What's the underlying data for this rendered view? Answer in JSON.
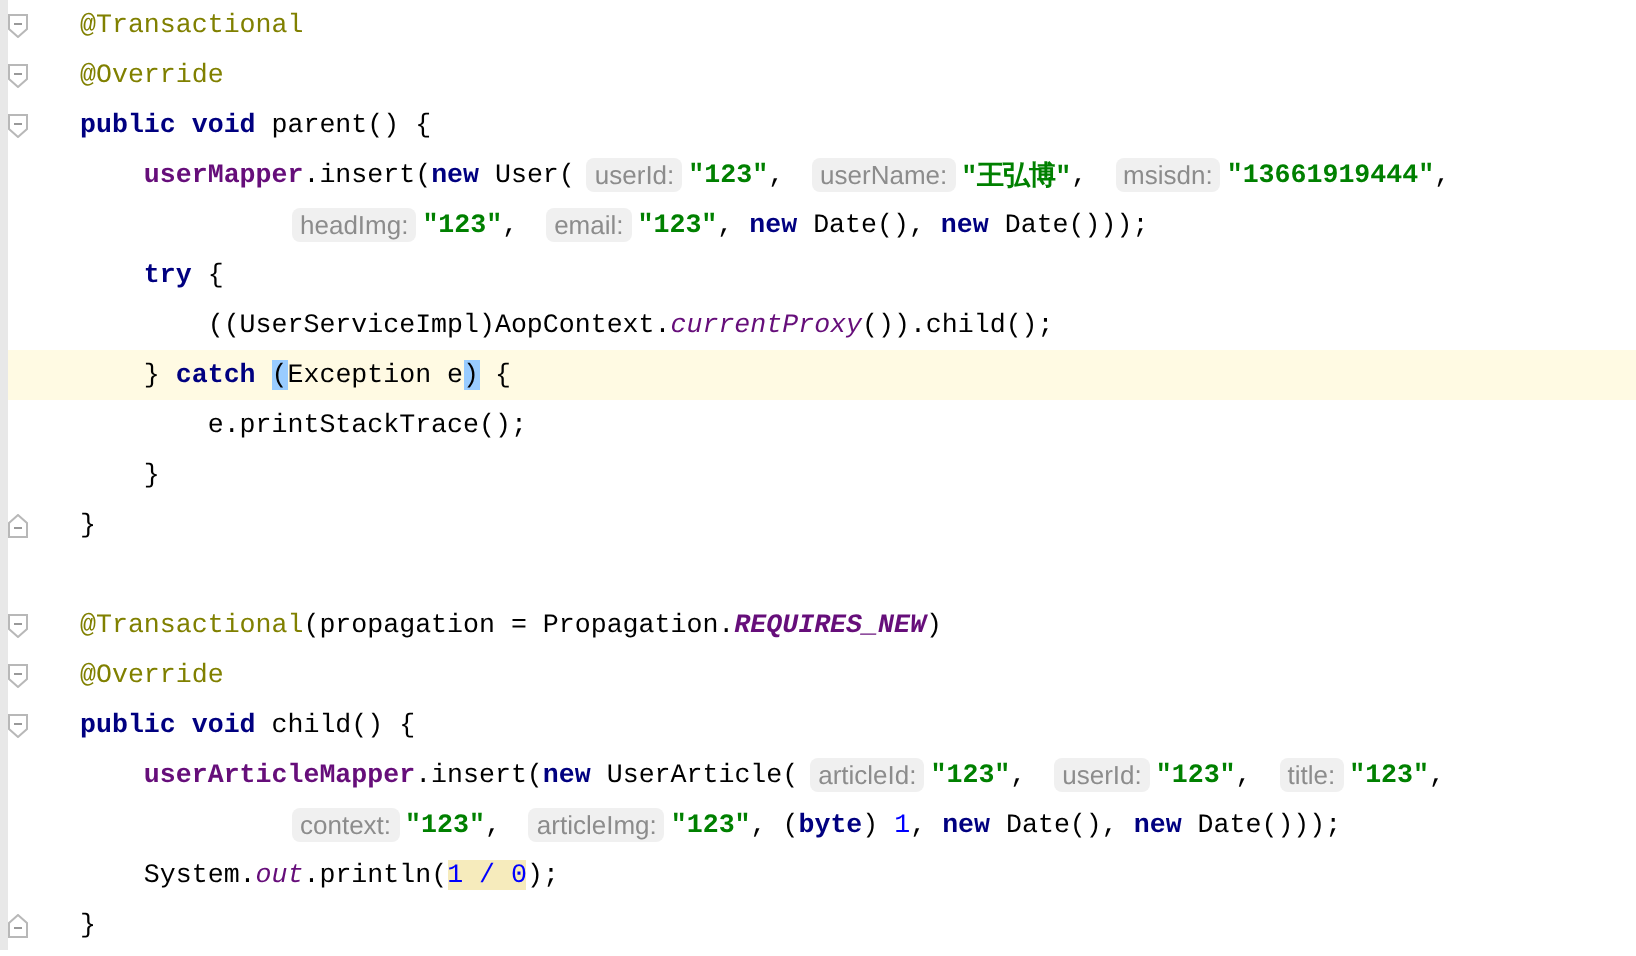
{
  "editor": {
    "lines": [
      {
        "current": false,
        "kind": "opener",
        "tokens": [
          {
            "kind": "annotation",
            "text": "@Transactional"
          }
        ]
      },
      {
        "current": false,
        "kind": "opener",
        "tokens": [
          {
            "kind": "annotation",
            "text": "@Override"
          }
        ]
      },
      {
        "current": false,
        "kind": "opener",
        "tokens": [
          {
            "kind": "keyword",
            "text": "public void"
          },
          {
            "kind": "plain",
            "text": " parent() {"
          }
        ]
      },
      {
        "current": false,
        "kind": "code",
        "tokens": [
          {
            "kind": "field",
            "text": "    userMapper"
          },
          {
            "kind": "plain",
            "text": ".insert("
          },
          {
            "kind": "keyword",
            "text": "new"
          },
          {
            "kind": "plain",
            "text": " User("
          },
          {
            "kind": "hint",
            "text": "userId:"
          },
          {
            "kind": "string",
            "text": "\"123\""
          },
          {
            "kind": "plain",
            "text": ", "
          },
          {
            "kind": "hint",
            "text": "userName:"
          },
          {
            "kind": "string",
            "text": "\"王弘博\""
          },
          {
            "kind": "plain",
            "text": ", "
          },
          {
            "kind": "hint",
            "text": "msisdn:"
          },
          {
            "kind": "string",
            "text": "\"13661919444\""
          },
          {
            "kind": "plain",
            "text": ","
          }
        ]
      },
      {
        "current": false,
        "kind": "code",
        "tokens": [
          {
            "kind": "hint",
            "text": "headImg:"
          },
          {
            "kind": "string",
            "text": "\"123\""
          },
          {
            "kind": "plain",
            "text": ", "
          },
          {
            "kind": "hint",
            "text": "email:"
          },
          {
            "kind": "string",
            "text": "\"123\""
          },
          {
            "kind": "plain",
            "text": ", "
          },
          {
            "kind": "keyword",
            "text": "new"
          },
          {
            "kind": "plain",
            "text": " Date(), "
          },
          {
            "kind": "keyword",
            "text": "new"
          },
          {
            "kind": "plain",
            "text": " Date()));"
          }
        ]
      },
      {
        "current": false,
        "kind": "code",
        "tokens": [
          {
            "kind": "keyword",
            "text": "    try"
          },
          {
            "kind": "plain",
            "text": " {"
          }
        ]
      },
      {
        "current": false,
        "kind": "code",
        "tokens": [
          {
            "kind": "plain",
            "text": "        ((UserServiceImpl)AopContext."
          },
          {
            "kind": "static",
            "text": "currentProxy"
          },
          {
            "kind": "plain",
            "text": "()).child();"
          }
        ]
      },
      {
        "current": true,
        "kind": "code",
        "tokens": [
          {
            "kind": "plain",
            "text": "    } "
          },
          {
            "kind": "keyword",
            "text": "catch "
          },
          {
            "kind": "brace",
            "text": "("
          },
          {
            "kind": "plain",
            "text": "Exception e"
          },
          {
            "kind": "brace",
            "text": ")"
          },
          {
            "kind": "plain",
            "text": " {"
          }
        ]
      },
      {
        "current": false,
        "kind": "code",
        "tokens": [
          {
            "kind": "plain",
            "text": "        e.printStackTrace();"
          }
        ]
      },
      {
        "current": false,
        "kind": "code",
        "tokens": [
          {
            "kind": "plain",
            "text": "    }"
          }
        ]
      },
      {
        "current": false,
        "kind": "closer",
        "tokens": [
          {
            "kind": "plain",
            "text": "}"
          }
        ]
      },
      {
        "current": false,
        "kind": "code"
      },
      {
        "current": false,
        "kind": "opener",
        "tokens": [
          {
            "kind": "annotation",
            "text": "@Transactional"
          },
          {
            "kind": "plain",
            "text": "(propagation = Propagation."
          },
          {
            "kind": "constant",
            "text": "REQUIRES_NEW"
          },
          {
            "kind": "plain",
            "text": ")"
          }
        ]
      },
      {
        "current": false,
        "kind": "opener",
        "tokens": [
          {
            "kind": "annotation",
            "text": "@Override"
          }
        ]
      },
      {
        "current": false,
        "kind": "opener",
        "tokens": [
          {
            "kind": "keyword",
            "text": "public void"
          },
          {
            "kind": "plain",
            "text": " child() {"
          }
        ]
      },
      {
        "current": false,
        "kind": "code",
        "tokens": [
          {
            "kind": "field",
            "text": "    userArticleMapper"
          },
          {
            "kind": "plain",
            "text": ".insert("
          },
          {
            "kind": "keyword",
            "text": "new"
          },
          {
            "kind": "plain",
            "text": " UserArticle("
          },
          {
            "kind": "hint",
            "text": "articleId:"
          },
          {
            "kind": "string",
            "text": "\"123\""
          },
          {
            "kind": "plain",
            "text": ", "
          },
          {
            "kind": "hint",
            "text": "userId:"
          },
          {
            "kind": "string",
            "text": "\"123\""
          },
          {
            "kind": "plain",
            "text": ", "
          },
          {
            "kind": "hint",
            "text": "title:"
          },
          {
            "kind": "string",
            "text": "\"123\""
          },
          {
            "kind": "plain",
            "text": ","
          }
        ]
      },
      {
        "current": false,
        "kind": "code",
        "tokens": [
          {
            "kind": "hint",
            "text": "context:"
          },
          {
            "kind": "string",
            "text": "\"123\""
          },
          {
            "kind": "plain",
            "text": ", "
          },
          {
            "kind": "hint",
            "text": "articleImg:"
          },
          {
            "kind": "string",
            "text": "\"123\""
          },
          {
            "kind": "plain",
            "text": ", ("
          },
          {
            "kind": "keyword",
            "text": "byte"
          },
          {
            "kind": "plain",
            "text": ") "
          },
          {
            "kind": "number",
            "text": "1"
          },
          {
            "kind": "plain",
            "text": ", "
          },
          {
            "kind": "keyword",
            "text": "new"
          },
          {
            "kind": "plain",
            "text": " Date(), "
          },
          {
            "kind": "keyword",
            "text": "new"
          },
          {
            "kind": "plain",
            "text": " Date()));"
          }
        ]
      },
      {
        "current": false,
        "kind": "code",
        "tokens": [
          {
            "kind": "plain",
            "text": "    System."
          },
          {
            "kind": "static",
            "text": "out"
          },
          {
            "kind": "plain",
            "text": ".println("
          },
          {
            "kind": "occurrence",
            "text": "1 / 0"
          },
          {
            "kind": "plain",
            "text": ");"
          }
        ]
      },
      {
        "current": false,
        "kind": "closer",
        "tokens": [
          {
            "kind": "plain",
            "text": "}"
          }
        ]
      }
    ]
  }
}
